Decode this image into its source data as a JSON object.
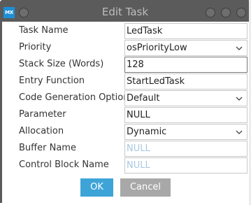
{
  "window": {
    "app_icon_text": "MX",
    "title": "Edit Task"
  },
  "fields": [
    {
      "label": "Task Name",
      "value": "LedTask",
      "type": "text"
    },
    {
      "label": "Priority",
      "value": "osPriorityLow",
      "type": "select"
    },
    {
      "label": "Stack Size (Words)",
      "value": "128",
      "type": "text"
    },
    {
      "label": "Entry Function",
      "value": "StartLedTask",
      "type": "text"
    },
    {
      "label": "Code Generation Option",
      "value": "Default",
      "type": "select"
    },
    {
      "label": "Parameter",
      "value": "NULL",
      "type": "text"
    },
    {
      "label": "Allocation",
      "value": "Dynamic",
      "type": "select"
    },
    {
      "label": "Buffer Name",
      "value": "NULL",
      "type": "placeholder"
    },
    {
      "label": "Control Block Name",
      "value": "NULL",
      "type": "placeholder"
    }
  ],
  "buttons": {
    "ok": "OK",
    "cancel": "Cancel"
  },
  "colors": {
    "titlebar": "#5b5b5b",
    "ok_button": "#3ea4d8",
    "cancel_button": "#a8a8a8",
    "placeholder_text": "#a9c7e3"
  }
}
